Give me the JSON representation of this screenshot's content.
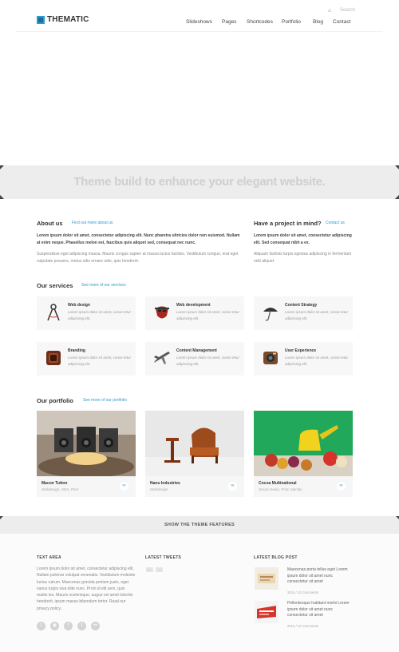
{
  "header": {
    "brand": "THEMATIC",
    "search_placeholder": "Search",
    "nav": [
      {
        "label": "Slideshows"
      },
      {
        "label": "Pages"
      },
      {
        "label": "Shortcodes"
      },
      {
        "label": "Portfolio"
      },
      {
        "label": "Blog"
      },
      {
        "label": "Contact"
      }
    ]
  },
  "banner": {
    "tagline": "Theme build to enhance your elegant website."
  },
  "about": {
    "title": "About us",
    "link": "Find out more about us",
    "intro": "Lorem ipsum dolor sit amet, consectetur adipiscing elit. Nunc pharetra ultricies dolor non euismod. Nullam at enim neque. Phasellus melon est, faucibus quis aliquet sed, consequat nec nunc.",
    "body": "Suspendisse eget adipiscing massa. Mauris congue sapien at massa luctus facilisis. Vestibulum congue, erat eget vulputate posuere, metus odio ornare odio, quis hendrerit."
  },
  "project": {
    "title": "Have a project in mind?",
    "link": "Contact us",
    "intro": "Lorem ipsum dolor sit amet, consectetur adipiscing elit. Sed consequat nibh a ex.",
    "body": "Aliquam facilisis turpis egestas adipiscing in fermentum velit aliquet."
  },
  "services": {
    "title": "Our services",
    "link": "See more of our services",
    "items": [
      {
        "title": "Web design",
        "desc": "Lorem ipsum dolor sit amet, conse tetur adipiscing elit.",
        "icon": "compass-icon"
      },
      {
        "title": "Web development",
        "desc": "Lorem ipsum dolor sit amet, conse tetur adipiscing elit.",
        "icon": "mask-icon"
      },
      {
        "title": "Content Strategy",
        "desc": "Lorem ipsum dolor sit amet, conse tetur adipiscing elit.",
        "icon": "umbrella-icon"
      },
      {
        "title": "Branding",
        "desc": "Lorem ipsum dolor sit amet, conse tetur adipiscing elit.",
        "icon": "badge-icon"
      },
      {
        "title": "Content Management",
        "desc": "Lorem ipsum dolor sit amet, conse tetur adipiscing elit.",
        "icon": "airplane-icon"
      },
      {
        "title": "User Experience",
        "desc": "Lorem ipsum dolor sit amet, conse tetur adipiscing elit.",
        "icon": "camera-icon"
      }
    ]
  },
  "portfolio": {
    "title": "Our portfolio",
    "link": "See more of our portfolio",
    "items": [
      {
        "title": "Macon Tutton",
        "meta": "Webdesign, SEO, Print"
      },
      {
        "title": "Nanu Industries",
        "meta": "Webdesign"
      },
      {
        "title": "Cocoa Multinational",
        "meta": "Social media, Print, Identity"
      }
    ]
  },
  "features_bar": {
    "label": "SHOW THE THEME FEATURES"
  },
  "footer": {
    "text_area": {
      "title": "TEXT AREA",
      "body": "Lorem ipsum dolor sit amet, consectetur adipiscing elit. Nullam pulvinar volutpat venenatis. Vestibulum molestie luctus rutrum. Maecenas gravida pretium justo, eget varius turpis viva elite nunc. Proin id elit sem, quis mattis leo. Mauris scelerisque, augue vel amet lobortis hendrerit, ipsum massa bibendum tortor. Read our privacy policy."
    },
    "tweets": {
      "title": "LATEST TWEETS"
    },
    "blog": {
      "title": "LATEST BLOG POST",
      "posts": [
        {
          "text": "Maecenas porta tellus eget Lorem ipsum dolor sit amet nunc consectetur sit amet",
          "date": "2015 / 10 Comments"
        },
        {
          "text": "Pellentesque habitant morbi Lorem ipsum dolor sit amet nunc consectetur sit amet",
          "date": "2015 / 10 Comments"
        }
      ]
    }
  },
  "colors": {
    "accent": "#2a9bcf",
    "banner_bg": "#ededed",
    "text": "#555555"
  }
}
